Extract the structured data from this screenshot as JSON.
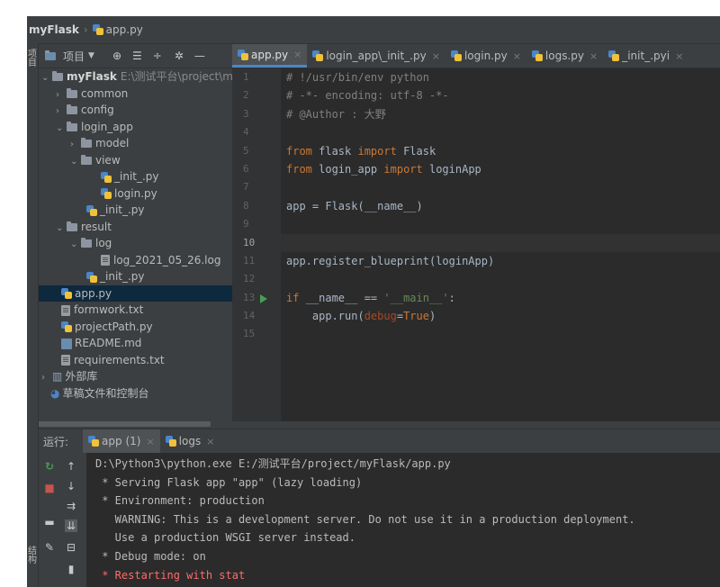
{
  "breadcrumb": {
    "project": "myFlask",
    "file": "app.py"
  },
  "project_panel": {
    "label": "项目"
  },
  "left_strip": {
    "label": "项目",
    "label2": "结构"
  },
  "editor_tabs": [
    {
      "label": "app.py"
    },
    {
      "label": "login_app\\_init_.py"
    },
    {
      "label": "login.py"
    },
    {
      "label": "logs.py"
    },
    {
      "label": "_init_.pyi"
    }
  ],
  "tree": [
    {
      "label": "myFlask",
      "path": "E:\\测试平台\\project\\myl"
    },
    {
      "label": "common"
    },
    {
      "label": "config"
    },
    {
      "label": "login_app"
    },
    {
      "label": "model"
    },
    {
      "label": "view"
    },
    {
      "label": "_init_.py"
    },
    {
      "label": "login.py"
    },
    {
      "label": "_init_.py"
    },
    {
      "label": "result"
    },
    {
      "label": "log"
    },
    {
      "label": "log_2021_05_26.log"
    },
    {
      "label": "_init_.py"
    },
    {
      "label": "app.py"
    },
    {
      "label": "formwork.txt"
    },
    {
      "label": "projectPath.py"
    },
    {
      "label": "README.md"
    },
    {
      "label": "requirements.txt"
    },
    {
      "label": "外部库"
    },
    {
      "label": "草稿文件和控制台"
    }
  ],
  "line_numbers": [
    "1",
    "2",
    "3",
    "4",
    "5",
    "6",
    "7",
    "8",
    "9",
    "10",
    "11",
    "12",
    "13",
    "14",
    "15"
  ],
  "code": {
    "l1": "# !/usr/bin/env python",
    "l2": "# -*- encoding: utf-8 -*-",
    "l3": "# @Author : 大野",
    "l5a": "from",
    "l5b": " flask ",
    "l5c": "import",
    "l5d": " Flask",
    "l6a": "from",
    "l6b": " login_app ",
    "l6c": "import",
    "l6d": " loginApp",
    "l8a": "app = Flask(",
    "l8b": "__name__",
    "l8c": ")",
    "l11": "app.register_blueprint(loginApp)",
    "l13a": "if ",
    "l13b": "__name__",
    "l13c": " == ",
    "l13d": "'__main__'",
    "l13e": ":",
    "l14a": "    app.run(",
    "l14b": "debug",
    "l14c": "=",
    "l14d": "True",
    "l14e": ")"
  },
  "run_panel": {
    "label": "运行:",
    "tabs": [
      {
        "label": "app (1)"
      },
      {
        "label": "logs"
      }
    ]
  },
  "console_lines": [
    "D:\\Python3\\python.exe E:/测试平台/project/myFlask/app.py",
    " * Serving Flask app \"app\" (lazy loading)",
    " * Environment: production",
    "   WARNING: This is a development server. Do not use it in a production deployment.",
    "   Use a production WSGI server instead.",
    " * Debug mode: on",
    " * Restarting with stat"
  ]
}
